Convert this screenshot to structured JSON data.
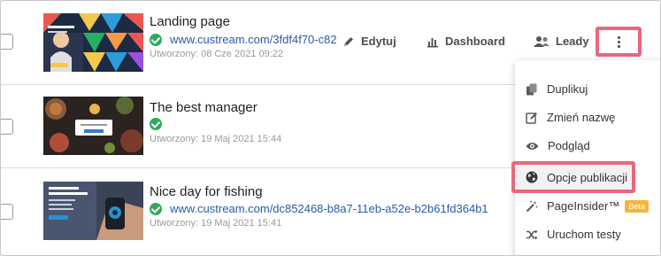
{
  "pages": [
    {
      "title": "Landing page",
      "url": "www.custream.com/3fdf4f70-c82",
      "created": "Utworzony: 08 Cze 2021 09:22"
    },
    {
      "title": "The best manager",
      "url": "",
      "created": "Utworzony: 19 Maj 2021 15:44"
    },
    {
      "title": "Nice day for fishing",
      "url": "www.custream.com/dc852468-b8a7-11eb-a52e-b2b61fd364b1",
      "created": "Utworzony: 19 Maj 2021 15:41"
    }
  ],
  "actions": {
    "edit": "Edytuj",
    "dashboard": "Dashboard",
    "leads": "Leady"
  },
  "menu": {
    "duplicate": "Duplikuj",
    "rename": "Zmień nazwę",
    "preview": "Podgląd",
    "publish_options": "Opcje publikacji",
    "pageinsider": "PageInsider™",
    "pageinsider_badge": "Beta",
    "run_tests": "Uruchom testy"
  },
  "colors": {
    "highlight_border": "#e9677d",
    "link": "#2a5aa8",
    "success": "#2eaa5a",
    "beta_badge": "#f3b53a"
  }
}
